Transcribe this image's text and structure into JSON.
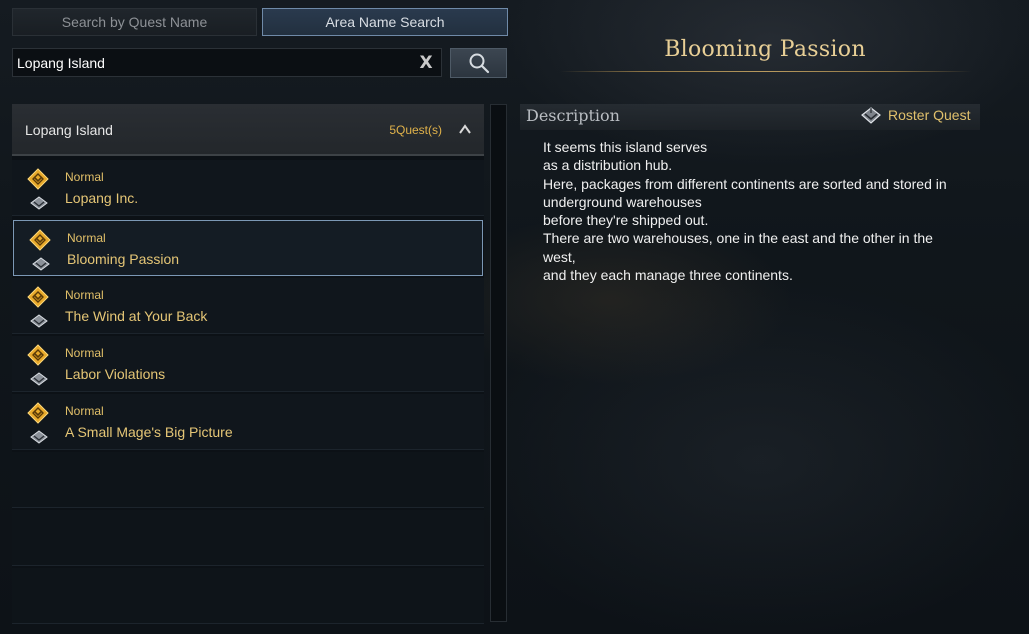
{
  "tabs": [
    {
      "label": "Search by Quest Name",
      "active": false
    },
    {
      "label": "Area Name Search",
      "active": true
    }
  ],
  "search": {
    "value": "Lopang Island",
    "placeholder": "",
    "clear_label": "X"
  },
  "group": {
    "name": "Lopang Island",
    "count": "5Quest(s)",
    "expanded": true
  },
  "quests": [
    {
      "type": "Normal",
      "name": "Lopang Inc.",
      "selected": false
    },
    {
      "type": "Normal",
      "name": "Blooming Passion",
      "selected": true
    },
    {
      "type": "Normal",
      "name": "The Wind at Your Back",
      "selected": false
    },
    {
      "type": "Normal",
      "name": "Labor Violations",
      "selected": false
    },
    {
      "type": "Normal",
      "name": "A Small Mage's Big Picture",
      "selected": false
    }
  ],
  "detail": {
    "title": "Blooming Passion",
    "description_label": "Description",
    "quest_kind": "Roster Quest",
    "description_lines": [
      "It seems this island serves",
      "as a distribution hub.",
      "Here, packages from different continents are sorted and stored in",
      "underground warehouses",
      "before they're shipped out.",
      "There are two warehouses, one in the east and the other in the",
      "west,",
      "and they each manage three continents."
    ]
  },
  "colors": {
    "accent_gold": "#e5c676",
    "selected_border": "#7c98b5",
    "active_tab": "#2a3a4e"
  },
  "icons": {
    "quest_type": "gold-diamond-icon",
    "roster": "roster-emblem-icon",
    "search": "search-icon",
    "collapse": "chevron-up-icon"
  }
}
